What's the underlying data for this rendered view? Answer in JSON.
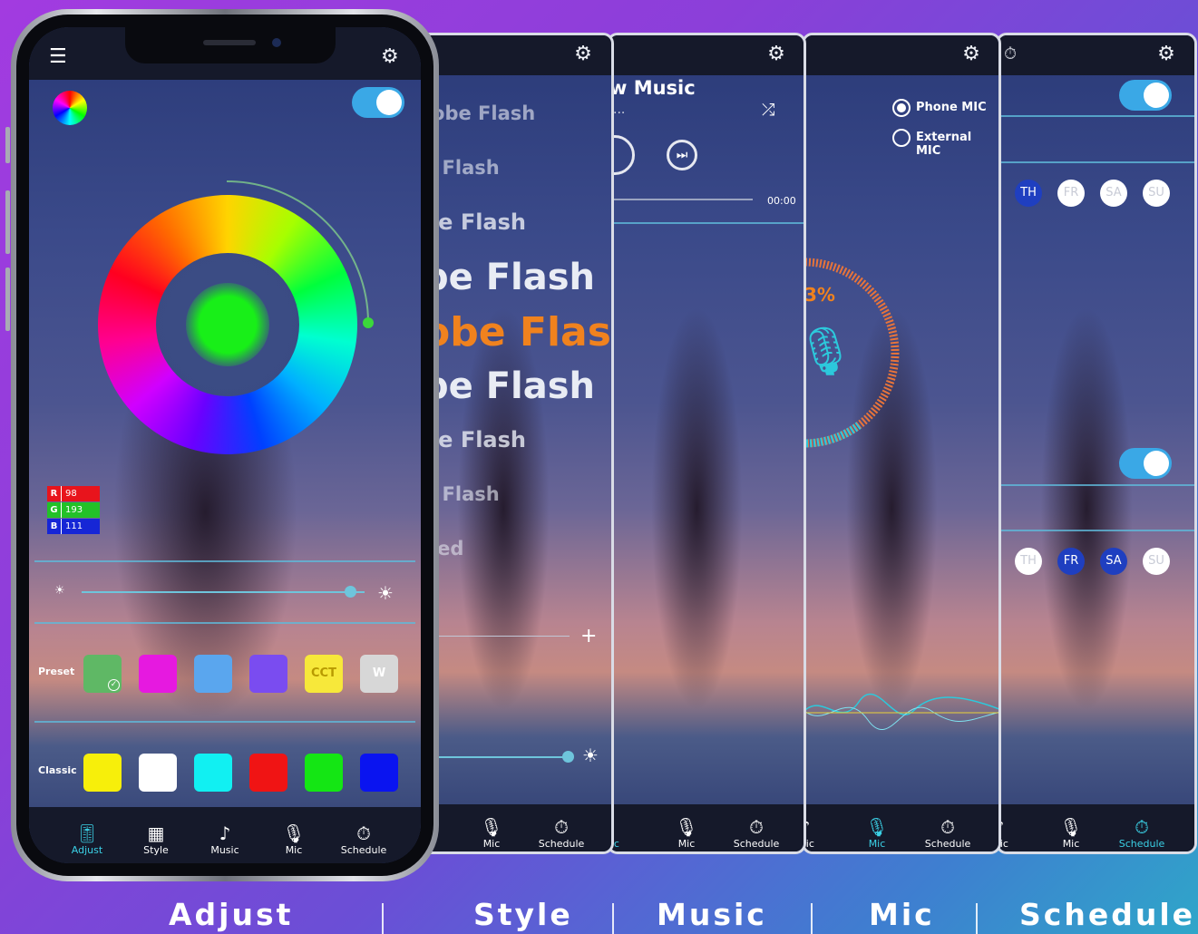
{
  "colors": {
    "accent": "#3bd1e6",
    "toggle": "#3aa8e6",
    "highlight_text": "#f0821e",
    "day_on": "#1f3fc0"
  },
  "adjust_screen": {
    "rgb": [
      {
        "label": "R",
        "value": "98",
        "color": "#e8141c"
      },
      {
        "label": "G",
        "value": "193",
        "color": "#23c128"
      },
      {
        "label": "B",
        "value": "111",
        "color": "#1626d6"
      }
    ],
    "brightness_level": 0.95,
    "preset_label": "Preset",
    "presets": [
      {
        "color": "#5fb865",
        "text": "",
        "selected": true
      },
      {
        "color": "#e619e0",
        "text": ""
      },
      {
        "color": "#5aa6ee",
        "text": ""
      },
      {
        "color": "#7a4cf0",
        "text": ""
      },
      {
        "color": "#f7e83a",
        "text": "CCT",
        "text_color": "#b89a00"
      },
      {
        "color": "#d7d7d7",
        "text": "W",
        "text_color": "#ffffff"
      }
    ],
    "classic_label": "Classic",
    "classics": [
      "#f7ef0a",
      "#ffffff",
      "#11f0f2",
      "#f01414",
      "#14e614",
      "#0a14f0"
    ]
  },
  "style_screen": {
    "items": [
      {
        "text": "tobe Flash",
        "size": 21,
        "opacity": 0.6
      },
      {
        "text": "e Flash",
        "size": 21,
        "opacity": 0.6
      },
      {
        "text": "be Flash",
        "size": 24,
        "opacity": 0.8
      },
      {
        "text": "be Flash",
        "size": 40,
        "opacity": 1
      },
      {
        "text": "obe Flash",
        "size": 44,
        "opacity": 1,
        "highlight": true
      },
      {
        "text": "be Flash",
        "size": 40,
        "opacity": 1
      },
      {
        "text": "be Flash",
        "size": 24,
        "opacity": 0.8
      },
      {
        "text": "e Flash",
        "size": 21,
        "opacity": 0.6
      },
      {
        "text": "Red",
        "size": 21,
        "opacity": 0.55
      }
    ],
    "plus": "+"
  },
  "music_screen": {
    "title": "w Music",
    "subtitle": "...",
    "time": "00:00"
  },
  "mic_screen": {
    "phone_mic": "Phone MIC",
    "external_mic": "External MIC",
    "percent": "3%",
    "level": 0.83
  },
  "schedule_screen": {
    "days_top": [
      {
        "label": "TH",
        "on": true
      },
      {
        "label": "FR",
        "on": false
      },
      {
        "label": "SA",
        "on": false
      },
      {
        "label": "SU",
        "on": false
      }
    ],
    "days_bottom": [
      {
        "label": "TH",
        "on": false
      },
      {
        "label": "FR",
        "on": true
      },
      {
        "label": "SA",
        "on": true
      },
      {
        "label": "SU",
        "on": false
      }
    ]
  },
  "nav": {
    "adjust": "Adjust",
    "style": "Style",
    "music": "Music",
    "mic": "Mic",
    "schedule": "Schedule",
    "partial_music": "usic"
  },
  "captions": [
    "Adjust",
    "Style",
    "Music",
    "Mic",
    "Schedule"
  ]
}
